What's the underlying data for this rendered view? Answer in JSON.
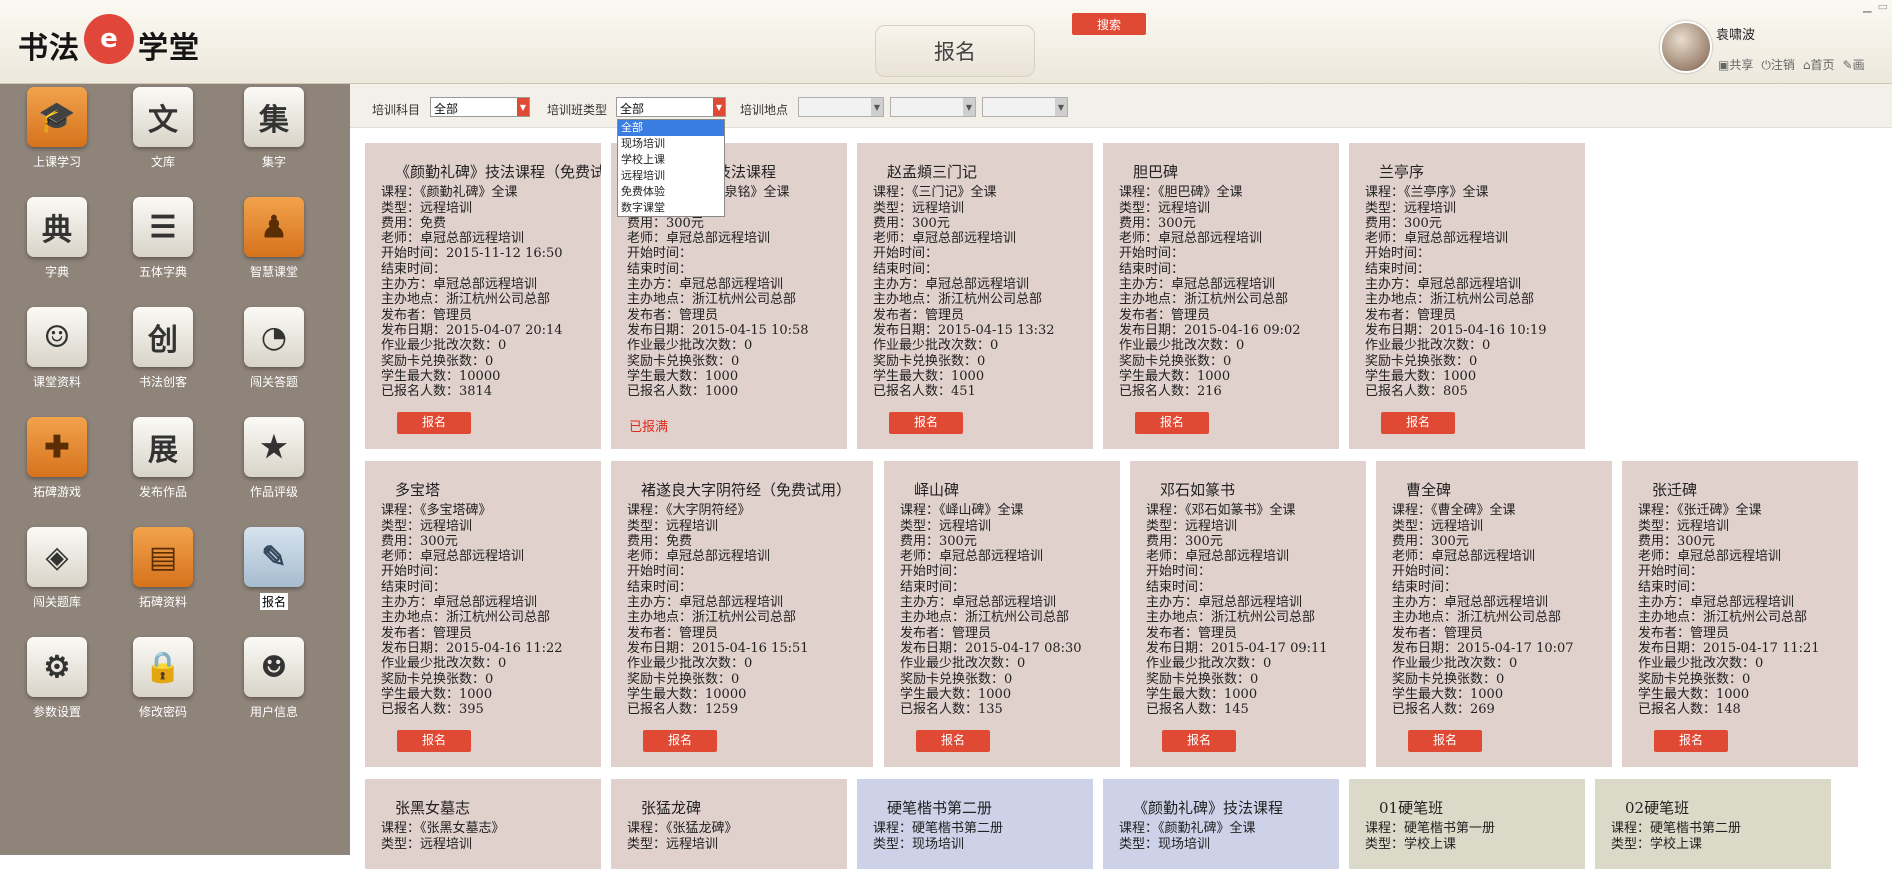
{
  "header": {
    "logo_part1": "书法",
    "logo_mark": "e",
    "logo_part2": "学堂",
    "page_title": "报名",
    "username": "袁啸波",
    "links": [
      "共享",
      "注销",
      "首页",
      "画"
    ]
  },
  "sidebar": {
    "items": [
      {
        "label": "上课学习",
        "icon": "graduation-cap-icon",
        "glyph": "🎓",
        "style": "orange"
      },
      {
        "label": "文库",
        "icon": "wen-icon",
        "glyph": "文",
        "style": "plain"
      },
      {
        "label": "集字",
        "icon": "ji-icon",
        "glyph": "集",
        "style": "plain"
      },
      {
        "label": "字典",
        "icon": "dian-icon",
        "glyph": "典",
        "style": "plain"
      },
      {
        "label": "五体字典",
        "icon": "book-icon",
        "glyph": "☰",
        "style": "plain"
      },
      {
        "label": "智慧课堂",
        "icon": "easel-icon",
        "glyph": "♟",
        "style": "orange"
      },
      {
        "label": "课堂资料",
        "icon": "group-icon",
        "glyph": "☺",
        "style": "plain"
      },
      {
        "label": "书法创客",
        "icon": "chuang-icon",
        "glyph": "创",
        "style": "plain"
      },
      {
        "label": "闯关答题",
        "icon": "pie-icon",
        "glyph": "◔",
        "style": "plain"
      },
      {
        "label": "拓碑游戏",
        "icon": "gamepad-icon",
        "glyph": "✚",
        "style": "orange"
      },
      {
        "label": "发布作品",
        "icon": "zhan-icon",
        "glyph": "展",
        "style": "plain"
      },
      {
        "label": "作品评级",
        "icon": "star-icon",
        "glyph": "★",
        "style": "plain"
      },
      {
        "label": "闯关题库",
        "icon": "layers-icon",
        "glyph": "◈",
        "style": "plain"
      },
      {
        "label": "拓碑资料",
        "icon": "book-stack-icon",
        "glyph": "▤",
        "style": "orange"
      },
      {
        "label": "报名",
        "icon": "edit-icon",
        "glyph": "✎",
        "style": "blue",
        "active": true
      },
      {
        "label": "参数设置",
        "icon": "gear-icon",
        "glyph": "⚙",
        "style": "plain"
      },
      {
        "label": "修改密码",
        "icon": "lock-icon",
        "glyph": "🔒",
        "style": "plain"
      },
      {
        "label": "用户信息",
        "icon": "user-icon",
        "glyph": "☻",
        "style": "plain"
      }
    ]
  },
  "filter": {
    "subject_label": "培训科目",
    "subject_value": "全部",
    "class_type_label": "培训班类型",
    "class_type_value": "全部",
    "location_label": "培训地点",
    "search_label": "搜索",
    "class_type_options": [
      "全部",
      "现场培训",
      "学校上课",
      "远程培训",
      "免费体验",
      "数字课堂"
    ],
    "class_type_selected_index": 0
  },
  "field_labels": {
    "course": "课程：",
    "type": "类型：",
    "fee": "费用：",
    "teacher": "老师：",
    "start": "开始时间：",
    "end": "结束时间：",
    "organizer": "主办方：",
    "venue": "主办地点：",
    "publisher": "发布者：",
    "published": "发布日期：",
    "min_batches": "作业最少批改次数：",
    "reward_cards": "奖励卡兑换张数：",
    "max_students": "学生最大数：",
    "enrolled": "已报名人数："
  },
  "courses": [
    {
      "title": "《颜勤礼碑》技法课程（免费试用）",
      "course": "《颜勤礼碑》全课",
      "type": "远程培训",
      "fee": "免费",
      "teacher": "卓冠总部远程培训",
      "start": "2015-11-12 16:50",
      "end": "",
      "organizer": "卓冠总部远程培训",
      "venue": "浙江杭州公司总部",
      "publisher": "管理员",
      "published": "2015-04-07 20:14",
      "min_batches": "0",
      "reward_cards": "0",
      "max_students": "10000",
      "enrolled": "3814",
      "button": "报名",
      "color": "pink"
    },
    {
      "title": "《九成宫》技法课程",
      "course": "《九成宫醴泉铭》全课",
      "type": "远程培训",
      "fee": "300元",
      "teacher": "卓冠总部远程培训",
      "start": "",
      "end": "",
      "organizer": "卓冠总部远程培训",
      "venue": "浙江杭州公司总部",
      "publisher": "管理员",
      "published": "2015-04-15 10:58",
      "min_batches": "0",
      "reward_cards": "0",
      "max_students": "1000",
      "enrolled": "1000",
      "status": "已报满",
      "color": "pink"
    },
    {
      "title": "赵孟頫三门记",
      "course": "《三门记》全课",
      "type": "远程培训",
      "fee": "300元",
      "teacher": "卓冠总部远程培训",
      "start": "",
      "end": "",
      "organizer": "卓冠总部远程培训",
      "venue": "浙江杭州公司总部",
      "publisher": "管理员",
      "published": "2015-04-15 13:32",
      "min_batches": "0",
      "reward_cards": "0",
      "max_students": "1000",
      "enrolled": "451",
      "button": "报名",
      "color": "pink"
    },
    {
      "title": "胆巴碑",
      "course": "《胆巴碑》全课",
      "type": "远程培训",
      "fee": "300元",
      "teacher": "卓冠总部远程培训",
      "start": "",
      "end": "",
      "organizer": "卓冠总部远程培训",
      "venue": "浙江杭州公司总部",
      "publisher": "管理员",
      "published": "2015-04-16 09:02",
      "min_batches": "0",
      "reward_cards": "0",
      "max_students": "1000",
      "enrolled": "216",
      "button": "报名",
      "color": "pink"
    },
    {
      "title": "兰亭序",
      "course": "《兰亭序》全课",
      "type": "远程培训",
      "fee": "300元",
      "teacher": "卓冠总部远程培训",
      "start": "",
      "end": "",
      "organizer": "卓冠总部远程培训",
      "venue": "浙江杭州公司总部",
      "publisher": "管理员",
      "published": "2015-04-16 10:19",
      "min_batches": "0",
      "reward_cards": "0",
      "max_students": "1000",
      "enrolled": "805",
      "button": "报名",
      "color": "pink"
    },
    {
      "title": "多宝塔",
      "course": "《多宝塔碑》",
      "type": "远程培训",
      "fee": "300元",
      "teacher": "卓冠总部远程培训",
      "start": "",
      "end": "",
      "organizer": "卓冠总部远程培训",
      "venue": "浙江杭州公司总部",
      "publisher": "管理员",
      "published": "2015-04-16 11:22",
      "min_batches": "0",
      "reward_cards": "0",
      "max_students": "1000",
      "enrolled": "395",
      "button": "报名",
      "color": "pink"
    },
    {
      "title": "褚遂良大字阴符经（免费试用）",
      "course": "《大字阴符经》",
      "type": "远程培训",
      "fee": "免费",
      "teacher": "卓冠总部远程培训",
      "start": "",
      "end": "",
      "organizer": "卓冠总部远程培训",
      "venue": "浙江杭州公司总部",
      "publisher": "管理员",
      "published": "2015-04-16 15:51",
      "min_batches": "0",
      "reward_cards": "0",
      "max_students": "10000",
      "enrolled": "1259",
      "button": "报名",
      "color": "pink"
    },
    {
      "title": "峄山碑",
      "course": "《峄山碑》全课",
      "type": "远程培训",
      "fee": "300元",
      "teacher": "卓冠总部远程培训",
      "start": "",
      "end": "",
      "organizer": "卓冠总部远程培训",
      "venue": "浙江杭州公司总部",
      "publisher": "管理员",
      "published": "2015-04-17 08:30",
      "min_batches": "0",
      "reward_cards": "0",
      "max_students": "1000",
      "enrolled": "135",
      "button": "报名",
      "color": "pink"
    },
    {
      "title": "邓石如篆书",
      "course": "《邓石如篆书》全课",
      "type": "远程培训",
      "fee": "300元",
      "teacher": "卓冠总部远程培训",
      "start": "",
      "end": "",
      "organizer": "卓冠总部远程培训",
      "venue": "浙江杭州公司总部",
      "publisher": "管理员",
      "published": "2015-04-17 09:11",
      "min_batches": "0",
      "reward_cards": "0",
      "max_students": "1000",
      "enrolled": "145",
      "button": "报名",
      "color": "pink"
    },
    {
      "title": "曹全碑",
      "course": "《曹全碑》全课",
      "type": "远程培训",
      "fee": "300元",
      "teacher": "卓冠总部远程培训",
      "start": "",
      "end": "",
      "organizer": "卓冠总部远程培训",
      "venue": "浙江杭州公司总部",
      "publisher": "管理员",
      "published": "2015-04-17 10:07",
      "min_batches": "0",
      "reward_cards": "0",
      "max_students": "1000",
      "enrolled": "269",
      "button": "报名",
      "color": "pink"
    },
    {
      "title": "张迁碑",
      "course": "《张迁碑》全课",
      "type": "远程培训",
      "fee": "300元",
      "teacher": "卓冠总部远程培训",
      "start": "",
      "end": "",
      "organizer": "卓冠总部远程培训",
      "venue": "浙江杭州公司总部",
      "publisher": "管理员",
      "published": "2015-04-17 11:21",
      "min_batches": "0",
      "reward_cards": "0",
      "max_students": "1000",
      "enrolled": "148",
      "button": "报名",
      "color": "pink"
    },
    {
      "title": "张黑女墓志",
      "course": "《张黑女墓志》",
      "type": "远程培训",
      "color": "pink"
    },
    {
      "title": "张猛龙碑",
      "course": "《张猛龙碑》",
      "type": "远程培训",
      "color": "pink"
    },
    {
      "title": "硬笔楷书第二册",
      "course": "硬笔楷书第二册",
      "type": "现场培训",
      "color": "blue"
    },
    {
      "title": "《颜勤礼碑》技法课程",
      "course": "《颜勤礼碑》全课",
      "type": "现场培训",
      "color": "blue"
    },
    {
      "title": "01硬笔班",
      "course": "硬笔楷书第一册",
      "type": "学校上课",
      "color": "olive"
    },
    {
      "title": "02硬笔班",
      "course": "硬笔楷书第二册",
      "type": "学校上课",
      "color": "olive"
    }
  ]
}
